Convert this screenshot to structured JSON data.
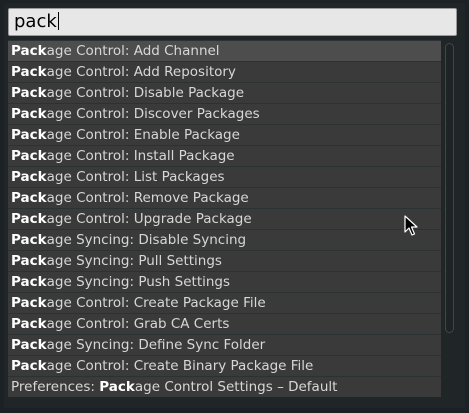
{
  "search": {
    "value": "pack"
  },
  "results": [
    {
      "match": "Pack",
      "prefix": "",
      "rest": "age Control: Add Channel",
      "selected": true
    },
    {
      "match": "Pack",
      "prefix": "",
      "rest": "age Control: Add Repository"
    },
    {
      "match": "Pack",
      "prefix": "",
      "rest": "age Control: Disable Package"
    },
    {
      "match": "Pack",
      "prefix": "",
      "rest": "age Control: Discover Packages"
    },
    {
      "match": "Pack",
      "prefix": "",
      "rest": "age Control: Enable Package"
    },
    {
      "match": "Pack",
      "prefix": "",
      "rest": "age Control: Install Package"
    },
    {
      "match": "Pack",
      "prefix": "",
      "rest": "age Control: List Packages"
    },
    {
      "match": "Pack",
      "prefix": "",
      "rest": "age Control: Remove Package"
    },
    {
      "match": "Pack",
      "prefix": "",
      "rest": "age Control: Upgrade Package"
    },
    {
      "match": "Pack",
      "prefix": "",
      "rest": "age Syncing: Disable Syncing"
    },
    {
      "match": "Pack",
      "prefix": "",
      "rest": "age Syncing: Pull Settings"
    },
    {
      "match": "Pack",
      "prefix": "",
      "rest": "age Syncing: Push Settings"
    },
    {
      "match": "Pack",
      "prefix": "",
      "rest": "age Control: Create Package File"
    },
    {
      "match": "Pack",
      "prefix": "",
      "rest": "age Control: Grab CA Certs"
    },
    {
      "match": "Pack",
      "prefix": "",
      "rest": "age Syncing: Define Sync Folder"
    },
    {
      "match": "Pack",
      "prefix": "",
      "rest": "age Control: Create Binary Package File"
    },
    {
      "match": "Pack",
      "prefix": "Preferences: ",
      "rest": "age Control Settings – Default"
    }
  ]
}
